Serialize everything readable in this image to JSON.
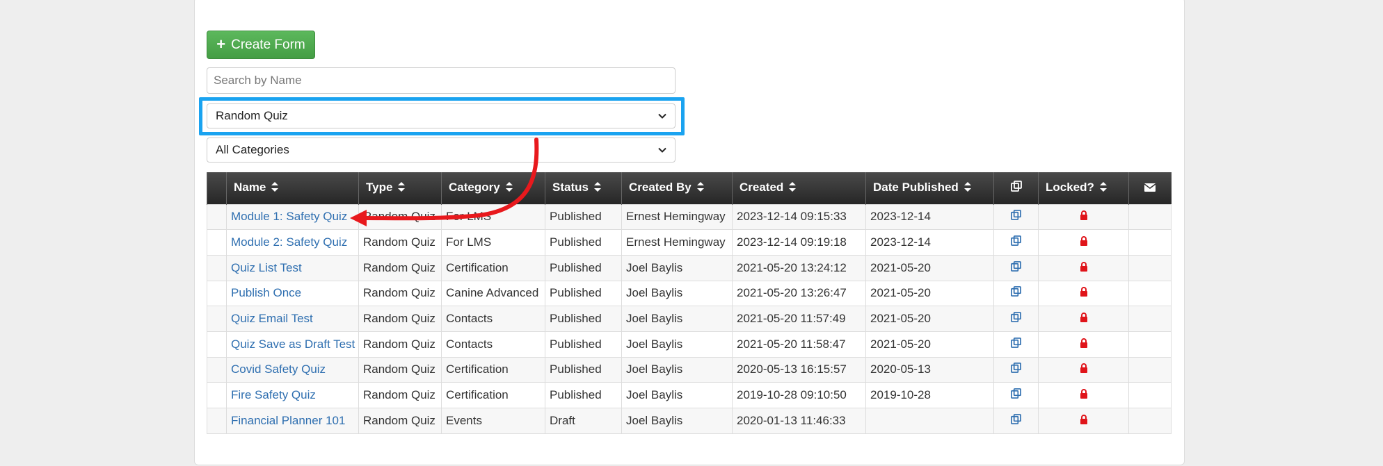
{
  "toolbar": {
    "create_label": "Create Form"
  },
  "search": {
    "placeholder": "Search by Name",
    "value": ""
  },
  "type_select": {
    "value": "Random Quiz"
  },
  "category_select": {
    "value": "All Categories"
  },
  "table": {
    "headers": {
      "name": "Name",
      "type": "Type",
      "category": "Category",
      "status": "Status",
      "created_by": "Created By",
      "created": "Created",
      "date_published": "Date Published",
      "locked": "Locked?"
    },
    "rows": [
      {
        "name": "Module 1: Safety Quiz",
        "type": "Random Quiz",
        "category": "For LMS",
        "status": "Published",
        "created_by": "Ernest Hemingway",
        "created": "2023-12-14 09:15:33",
        "published": "2023-12-14"
      },
      {
        "name": "Module 2: Safety Quiz",
        "type": "Random Quiz",
        "category": "For LMS",
        "status": "Published",
        "created_by": "Ernest Hemingway",
        "created": "2023-12-14 09:19:18",
        "published": "2023-12-14"
      },
      {
        "name": "Quiz List Test",
        "type": "Random Quiz",
        "category": "Certification",
        "status": "Published",
        "created_by": "Joel Baylis",
        "created": "2021-05-20 13:24:12",
        "published": "2021-05-20"
      },
      {
        "name": "Publish Once",
        "type": "Random Quiz",
        "category": "Canine Advanced",
        "status": "Published",
        "created_by": "Joel Baylis",
        "created": "2021-05-20 13:26:47",
        "published": "2021-05-20"
      },
      {
        "name": "Quiz Email Test",
        "type": "Random Quiz",
        "category": "Contacts",
        "status": "Published",
        "created_by": "Joel Baylis",
        "created": "2021-05-20 11:57:49",
        "published": "2021-05-20"
      },
      {
        "name": "Quiz Save as Draft Test",
        "type": "Random Quiz",
        "category": "Contacts",
        "status": "Published",
        "created_by": "Joel Baylis",
        "created": "2021-05-20 11:58:47",
        "published": "2021-05-20"
      },
      {
        "name": "Covid Safety Quiz",
        "type": "Random Quiz",
        "category": "Certification",
        "status": "Published",
        "created_by": "Joel Baylis",
        "created": "2020-05-13 16:15:57",
        "published": "2020-05-13"
      },
      {
        "name": "Fire Safety Quiz",
        "type": "Random Quiz",
        "category": "Certification",
        "status": "Published",
        "created_by": "Joel Baylis",
        "created": "2019-10-28 09:10:50",
        "published": "2019-10-28"
      },
      {
        "name": "Financial Planner 101",
        "type": "Random Quiz",
        "category": "Events",
        "status": "Draft",
        "created_by": "Joel Baylis",
        "created": "2020-01-13 11:46:33",
        "published": ""
      }
    ]
  },
  "colors": {
    "accent_highlight": "#1aa3f0",
    "arrow": "#e8191d",
    "lock": "#e0141a",
    "link": "#2f6fb0",
    "create_button": "#5cb85c"
  }
}
